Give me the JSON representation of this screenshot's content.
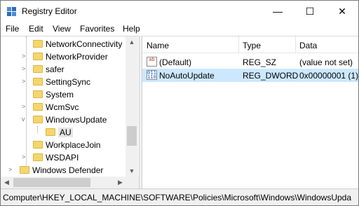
{
  "window": {
    "title": "Registry Editor",
    "min_glyph": "—",
    "max_glyph": "☐",
    "close_glyph": "✕"
  },
  "menu": [
    "File",
    "Edit",
    "View",
    "Favorites",
    "Help"
  ],
  "tree": {
    "items": [
      {
        "label": "NetworkConnectivity",
        "expander": "",
        "icon": "folder-icon"
      },
      {
        "label": "NetworkProvider",
        "expander": ">",
        "icon": "folder-icon"
      },
      {
        "label": "safer",
        "expander": ">",
        "icon": "folder-icon"
      },
      {
        "label": "SettingSync",
        "expander": ">",
        "icon": "folder-icon"
      },
      {
        "label": "System",
        "expander": "",
        "icon": "folder-icon"
      },
      {
        "label": "WcmSvc",
        "expander": ">",
        "icon": "folder-icon"
      },
      {
        "label": "WindowsUpdate",
        "expander": "v",
        "icon": "folder-icon"
      },
      {
        "label": "AU",
        "expander": "",
        "icon": "folder-icon",
        "selected": true
      },
      {
        "label": "WorkplaceJoin",
        "expander": "",
        "icon": "folder-icon"
      },
      {
        "label": "WSDAPI",
        "expander": ">",
        "icon": "folder-icon"
      },
      {
        "label": "Windows Defender",
        "expander": ">",
        "icon": "folder-icon"
      }
    ]
  },
  "list": {
    "columns": [
      "Name",
      "Type",
      "Data"
    ],
    "rows": [
      {
        "name": "(Default)",
        "type": "REG_SZ",
        "data": "(value not set)",
        "icon": "string-value-icon",
        "icon_text": "ab"
      },
      {
        "name": "NoAutoUpdate",
        "type": "REG_DWORD",
        "data": "0x00000001 (1)",
        "icon": "binary-value-icon",
        "icon_text": "011 110",
        "selected": true
      }
    ]
  },
  "status": {
    "path": "Computer\\HKEY_LOCAL_MACHINE\\SOFTWARE\\Policies\\Microsoft\\Windows\\WindowsUpda"
  },
  "colors": {
    "selection": "#cce8ff",
    "folder": "#f6d66b"
  }
}
